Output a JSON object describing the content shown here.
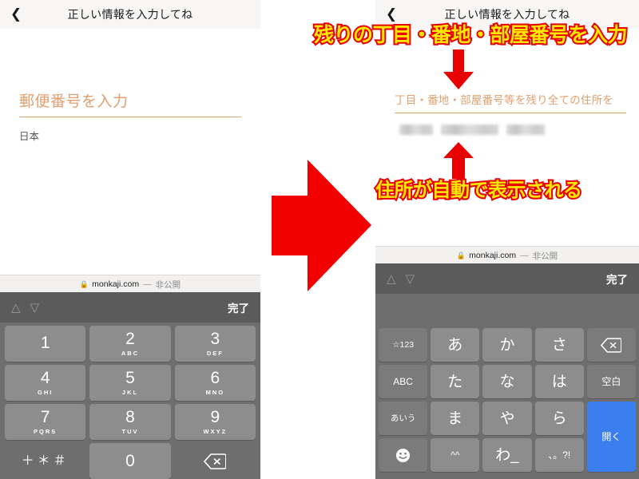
{
  "meta": {
    "accent_orange": "#e0a070",
    "annotation_fill": "#ffe800",
    "annotation_stroke": "#e60000",
    "arrow_red": "#f00000",
    "keyboard_bg": "#6e6e6e",
    "key_bg": "#8d8d8d",
    "enter_key_blue": "#3b7ef0"
  },
  "left_panel": {
    "navbar": {
      "back_icon": "chevron-left-icon",
      "title": "正しい情報を入力してね"
    },
    "form": {
      "postal_field": {
        "placeholder": "郵便番号を入力",
        "value": ""
      },
      "country_value": "日本"
    },
    "urlbar": {
      "lock_icon": "lock-icon",
      "domain": "monkaji.com",
      "separator": "—",
      "private_label": "非公開"
    },
    "kbtoolbar": {
      "prev_icon": "chevron-up-icon",
      "next_icon": "chevron-down-icon",
      "done_label": "完了"
    },
    "keypad": {
      "type": "numeric",
      "rows": [
        [
          {
            "num": "1",
            "sub": ""
          },
          {
            "num": "2",
            "sub": "ABC"
          },
          {
            "num": "3",
            "sub": "DEF"
          }
        ],
        [
          {
            "num": "4",
            "sub": "GHI"
          },
          {
            "num": "5",
            "sub": "JKL"
          },
          {
            "num": "6",
            "sub": "MNO"
          }
        ],
        [
          {
            "num": "7",
            "sub": "PQRS"
          },
          {
            "num": "8",
            "sub": "TUV"
          },
          {
            "num": "9",
            "sub": "WXYZ"
          }
        ]
      ],
      "bottom": {
        "symbols_label": "＋＊＃",
        "zero_label": "0",
        "delete_icon": "delete-backward-icon"
      }
    }
  },
  "right_panel": {
    "navbar": {
      "back_icon": "chevron-left-icon",
      "title": "正しい情報を入力してね"
    },
    "form": {
      "address_field": {
        "placeholder": "丁目・番地・部屋番号等を残り全ての住所を",
        "value": ""
      },
      "autofilled_address": "（自動表示された住所・マスク済み）"
    },
    "urlbar": {
      "lock_icon": "lock-icon",
      "domain": "monkaji.com",
      "separator": "—",
      "private_label": "非公開"
    },
    "kbtoolbar": {
      "prev_icon": "chevron-up-icon",
      "next_icon": "chevron-down-icon",
      "done_label": "完了"
    },
    "keyboard": {
      "type": "japanese-kana",
      "suggestion_bar": "",
      "rows": [
        [
          {
            "label": "☆123",
            "style": "dark"
          },
          {
            "label": "あ",
            "style": "kana"
          },
          {
            "label": "か",
            "style": "kana"
          },
          {
            "label": "さ",
            "style": "kana"
          },
          {
            "label": "delete-backward-icon",
            "style": "dark"
          }
        ],
        [
          {
            "label": "ABC",
            "style": "dark"
          },
          {
            "label": "た",
            "style": "kana"
          },
          {
            "label": "な",
            "style": "kana"
          },
          {
            "label": "は",
            "style": "kana"
          },
          {
            "label": "空白",
            "style": "dark"
          }
        ],
        [
          {
            "label": "あいう",
            "style": "dark"
          },
          {
            "label": "ま",
            "style": "kana"
          },
          {
            "label": "や",
            "style": "kana"
          },
          {
            "label": "ら",
            "style": "kana"
          },
          {
            "label": "開く",
            "style": "blue"
          }
        ],
        [
          {
            "label": "emoji-face-icon",
            "style": "dark"
          },
          {
            "label": "^^",
            "style": "kana"
          },
          {
            "label": "わ_",
            "style": "kana"
          },
          {
            "label": "、。?!",
            "style": "kana"
          }
        ]
      ]
    }
  },
  "annotations": {
    "top": "残りの丁目・番地・部屋番号を入力",
    "middle": "住所が自動で表示される",
    "arrow_transition": "big-right-arrow-icon",
    "arrow_down": "down-arrow-icon",
    "arrow_up": "up-arrow-icon"
  }
}
